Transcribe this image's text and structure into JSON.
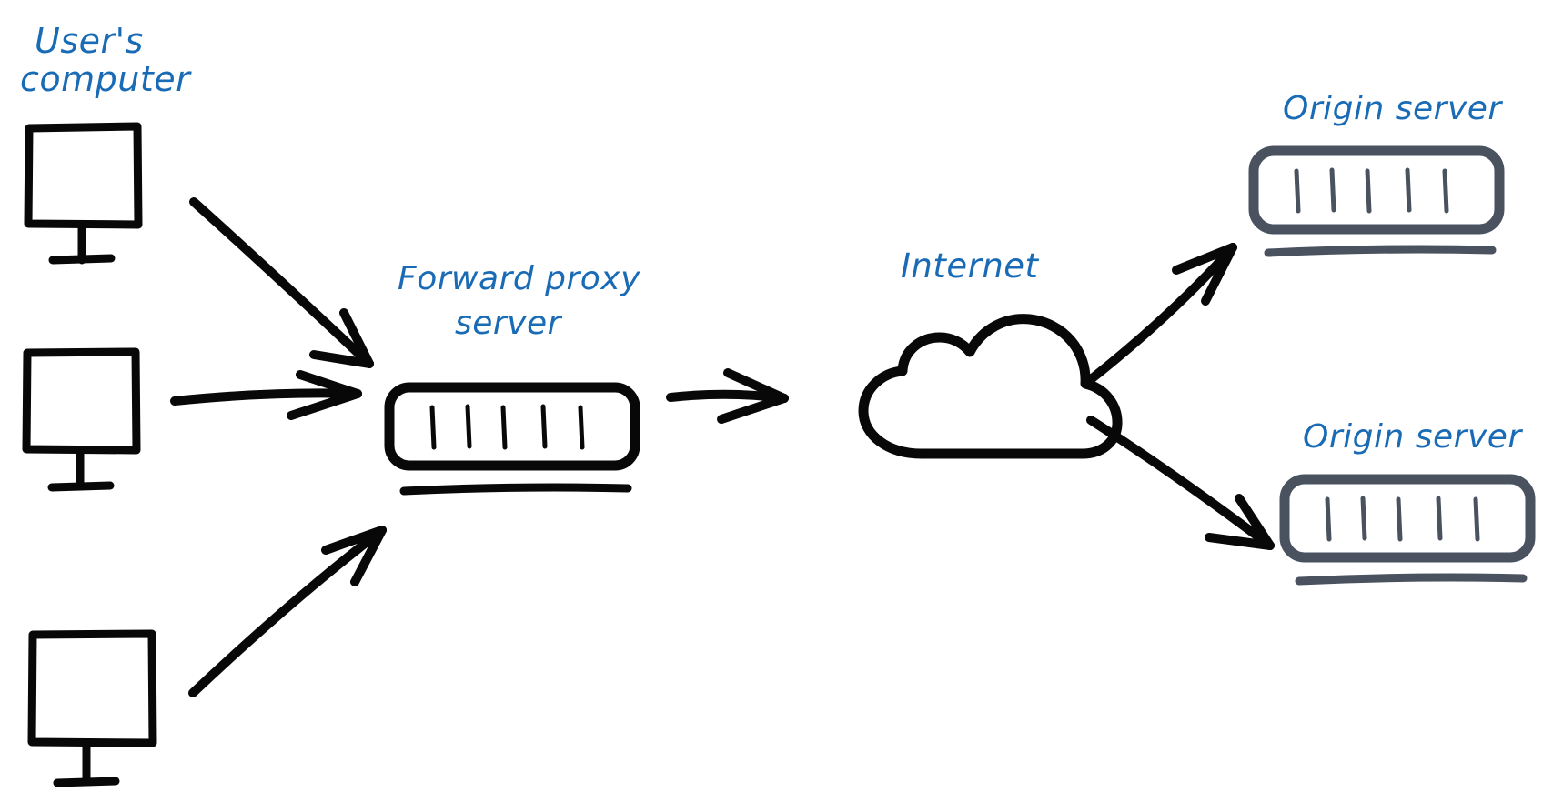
{
  "diagram": {
    "title": "Forward proxy server network diagram",
    "background_color": "#ffffff",
    "label_color": "#1a6bb5",
    "ink_color": "#080808",
    "slate_color": "#4a5260",
    "labels": {
      "users_computer_line1": "User's",
      "users_computer_line2": "computer",
      "forward_proxy_line1": "Forward proxy",
      "forward_proxy_line2": "server",
      "internet": "Internet",
      "origin_server_top": "Origin server",
      "origin_server_bottom": "Origin server"
    },
    "nodes": [
      {
        "id": "client-1",
        "type": "monitor",
        "label": "User's computer",
        "color": "#080808"
      },
      {
        "id": "client-2",
        "type": "monitor",
        "label": "User's computer",
        "color": "#080808"
      },
      {
        "id": "client-3",
        "type": "monitor",
        "label": "User's computer",
        "color": "#080808"
      },
      {
        "id": "forward-proxy-server",
        "type": "server",
        "label": "Forward proxy server",
        "color": "#080808",
        "slot_count": 5
      },
      {
        "id": "internet-cloud",
        "type": "cloud",
        "label": "Internet",
        "color": "#080808"
      },
      {
        "id": "origin-server-top",
        "type": "server",
        "label": "Origin server",
        "color": "#4a5260",
        "slot_count": 5
      },
      {
        "id": "origin-server-bottom",
        "type": "server",
        "label": "Origin server",
        "color": "#4a5260",
        "slot_count": 5
      }
    ],
    "edges": [
      {
        "id": "edge-client1-proxy",
        "from": "client-1",
        "to": "forward-proxy-server",
        "direction": "down-right"
      },
      {
        "id": "edge-client2-proxy",
        "from": "client-2",
        "to": "forward-proxy-server",
        "direction": "right"
      },
      {
        "id": "edge-client3-proxy",
        "from": "client-3",
        "to": "forward-proxy-server",
        "direction": "up-right"
      },
      {
        "id": "edge-proxy-internet",
        "from": "forward-proxy-server",
        "to": "internet-cloud",
        "direction": "right"
      },
      {
        "id": "edge-internet-origin-top",
        "from": "internet-cloud",
        "to": "origin-server-top",
        "direction": "up-right"
      },
      {
        "id": "edge-internet-origin-bottom",
        "from": "internet-cloud",
        "to": "origin-server-bottom",
        "direction": "down-right"
      }
    ]
  }
}
